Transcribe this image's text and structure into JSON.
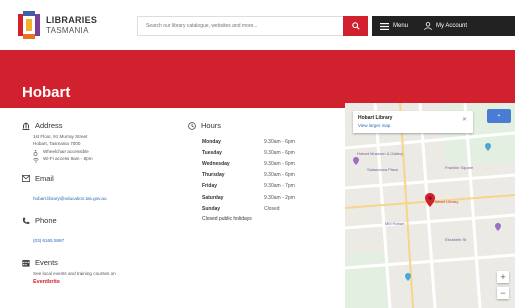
{
  "header": {
    "logo_line1": "LIBRARIES",
    "logo_line2": "TASMANIA",
    "search_placeholder": "Search our library catalogue, websites and more...",
    "menu_label": "Menu",
    "account_label": "My Account"
  },
  "page": {
    "title": "Hobart"
  },
  "address": {
    "heading": "Address",
    "line1": "1st Floor, 91 Murray Street",
    "line2": "Hobart, Tasmania 7000",
    "wheelchair": "Wheelchair accessible",
    "wifi": "Wi-Fi access 8am - 8pm"
  },
  "email": {
    "heading": "Email",
    "value": "hobart.library@education.tas.gov.au"
  },
  "phone": {
    "heading": "Phone",
    "value": "(03) 6165 5597"
  },
  "events": {
    "heading": "Events",
    "text": "See local events and training courses on",
    "link": "Eventbrite"
  },
  "hours": {
    "heading": "Hours",
    "rows": [
      {
        "day": "Monday",
        "time": "9.30am - 6pm"
      },
      {
        "day": "Tuesday",
        "time": "9.30am - 6pm"
      },
      {
        "day": "Wednesday",
        "time": "9.30am - 6pm"
      },
      {
        "day": "Thursday",
        "time": "9.30am - 6pm"
      },
      {
        "day": "Friday",
        "time": "9.30am - 7pm"
      },
      {
        "day": "Saturday",
        "time": "9.30am - 2pm"
      },
      {
        "day": "Sunday",
        "time": "Closed"
      }
    ],
    "note": "Closed public holidays"
  },
  "map": {
    "card_title": "Hobart Library",
    "card_link": "View larger map",
    "pin_label": "Hobart Library",
    "corner_label": "+",
    "zoom_in": "+",
    "zoom_out": "−",
    "labels": [
      "Hobart Museum & Gallery",
      "Salamanca Place",
      "Franklin Square",
      "Hobart Library",
      "Mid Hobart",
      "Elizabeth St"
    ]
  },
  "colors": {
    "brand_red": "#d1202e",
    "nav_dark": "#222222",
    "link_blue": "#2a6ab8"
  }
}
